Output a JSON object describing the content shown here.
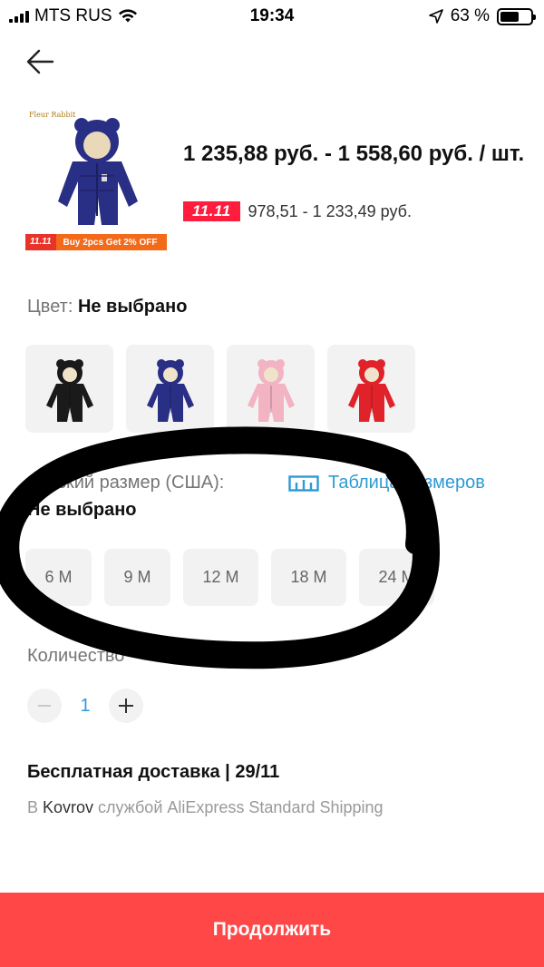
{
  "status_bar": {
    "carrier": "MTS RUS",
    "time": "19:34",
    "battery": "63 %",
    "battery_level": 0.63
  },
  "product": {
    "brand_text": "Fleur Rabbit",
    "promo_tag": "11.11",
    "promo_text": "Buy 2pcs Get 2% OFF",
    "price_range": "1 235,88 руб. - 1 558,60 руб. / шт.",
    "sale_badge": "11.11",
    "sale_price": "978,51 - 1 233,49 руб."
  },
  "color": {
    "label": "Цвет:",
    "value": "Не выбрано",
    "swatches": [
      {
        "name": "black",
        "hex": "#1a1a1a"
      },
      {
        "name": "navy",
        "hex": "#2a2f86"
      },
      {
        "name": "pink",
        "hex": "#f2b3c2"
      },
      {
        "name": "red",
        "hex": "#e0232b"
      }
    ]
  },
  "size": {
    "label": "Детский размер (США):",
    "table_link": "Таблица размеров",
    "value": "Не выбрано",
    "options": [
      "6 M",
      "9 M",
      "12 M",
      "18 M",
      "24 M"
    ]
  },
  "quantity": {
    "label": "Количество",
    "value": "1"
  },
  "delivery": {
    "title": "Бесплатная доставка | 29/11",
    "prefix": "В ",
    "city": "Kovrov",
    "suffix": " службой AliExpress Standard Shipping"
  },
  "continue_label": "Продолжить",
  "colors": {
    "accent_red": "#ff4747",
    "link_blue": "#2e9ad6",
    "sale_red": "#ff1c3c"
  }
}
